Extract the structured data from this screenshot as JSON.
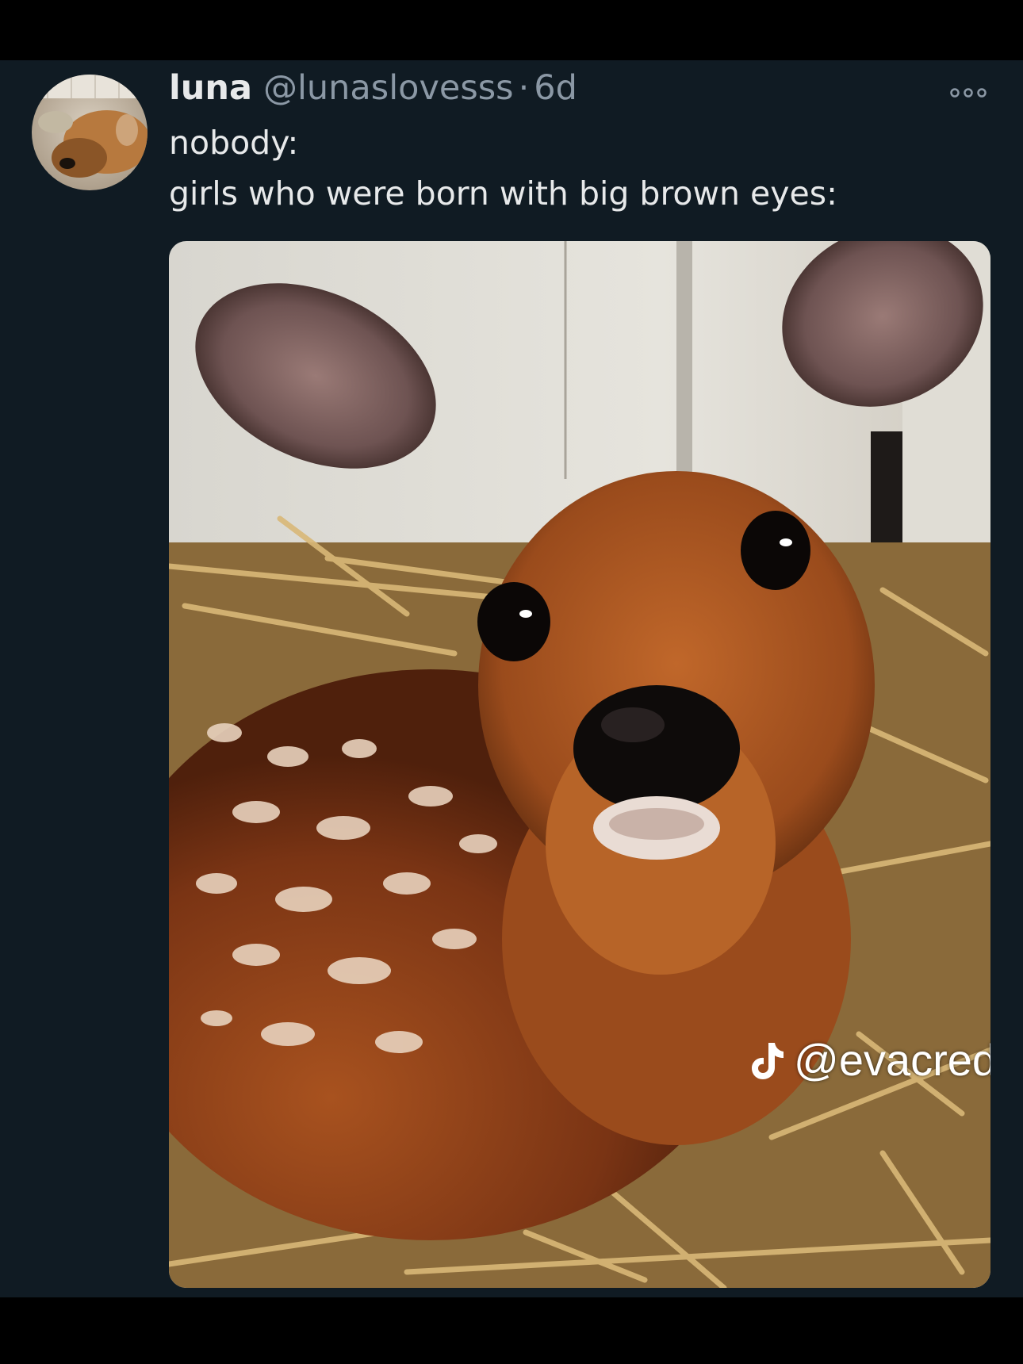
{
  "tweet": {
    "display_name": "luna",
    "handle": "@lunaslovesss",
    "separator": "·",
    "timestamp": "6d",
    "text_lines": [
      "nobody:",
      "girls who were born with big brown eyes:"
    ]
  },
  "media": {
    "watermark_handle": "@evacred"
  },
  "icons": {
    "more": "more-horizontal-icon",
    "watermark": "tiktok-icon",
    "avatar": "avatar-photo"
  },
  "colors": {
    "background": "#101b23",
    "primary_text": "#e7e9ea",
    "secondary_text": "#8b98a5",
    "frame": "#000000"
  }
}
